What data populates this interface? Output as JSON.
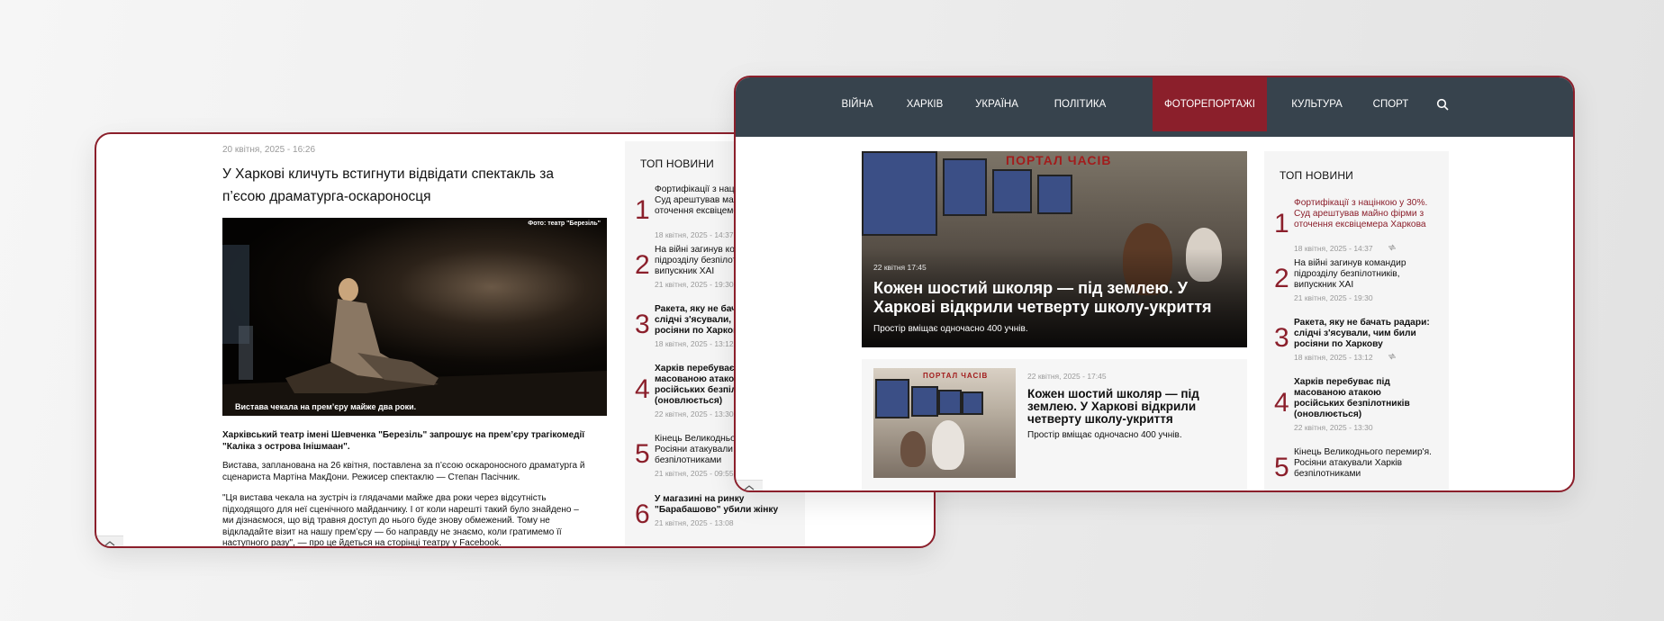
{
  "article": {
    "date": "20 квітня, 2025 - 16:26",
    "title": "У Харкові кличуть встигнути відвідати спектакль за п’єсою драматурга-оскароносця",
    "photo_credit": "Фото: театр \"Березіль\"",
    "photo_caption": "Вистава чекала на прем’єру майже два роки.",
    "lead": "Харківський театр імені Шевченка \"Березіль\" запрошує на прем’єру трагікомедії \"Каліка з острова Інішмаан\".",
    "para1": "Вистава, запланована на 26 квітня, поставлена за п’єсою оскароносного драматурга й сценариста Мартіна МакДони. Режисер спектаклю —  Степан Пасічник.",
    "para2": "\"Ця вистава чекала на зустріч із глядачами майже два роки через відсутність підходящого для неї сценічного майданчику. І от коли нарешті такий було знайдено – ми дізнаємося, що від травня доступ до нього буде знову обмежений. Тому не відкладайте візит на нашу прем’єру — бо направду не знаємо, коли гратимемо її наступного разу\", — про це йдеться на сторінці театру у Facebook."
  },
  "top_news": {
    "heading": "ТОП НОВИНИ",
    "items": [
      {
        "num": "1",
        "title": "Фортифікації з націнкою у 30%. Суд арештував майно фірми з оточення ексвіцемера Харкова",
        "date": "18 квітня, 2025 - 14:37"
      },
      {
        "num": "2",
        "title": "На війні загинув командир підрозділу безпілотників, випускник ХАІ",
        "date": "21 квітня, 2025 - 19:30"
      },
      {
        "num": "3",
        "title": "Ракета, яку не бачать радари: слідчі з'ясували, чим били росіяни по Харкову",
        "date": "18 квітня, 2025 - 13:12"
      },
      {
        "num": "4",
        "title": "Харків перебуває під масованою атакою російських безпілотників (оновлюється)",
        "date": "22 квітня, 2025 - 13:30"
      },
      {
        "num": "5",
        "title": "Кінець Великоднього перемир'я. Росіяни атакували Харків безпілотниками",
        "date": "21 квітня, 2025 - 09:55"
      },
      {
        "num": "6",
        "title": "У магазині на ринку \"Барабашово\" убили жінку",
        "date": "21 квітня, 2025 - 13:08"
      }
    ]
  },
  "nav": {
    "items": [
      "ВІЙНА",
      "ХАРКІВ",
      "УКРАЇНА",
      "ПОЛІТИКА",
      "ФОТОРЕПОРТАЖІ",
      "КУЛЬТУРА",
      "СПОРТ"
    ],
    "active": "ФОТОРЕПОРТАЖІ",
    "search_icon": "search-icon"
  },
  "hero": {
    "date": "22 квітня 17:45",
    "title": "Кожен шостий школяр — під землею. У Харкові відкрили четверту школу-укриття",
    "subtitle": "Простір вміщає одночасно 400 учнів.",
    "sign": "ПОРТАЛ ЧАСІВ"
  },
  "card": {
    "date": "22 квітня, 2025 - 17:45",
    "title": "Кожен шостий школяр — під землею. У Харкові відкрили четверту школу-укриття",
    "subtitle": "Простір вміщає одночасно 400 учнів.",
    "sign": "ПОРТАЛ ЧАСІВ"
  },
  "colors": {
    "accent": "#8b1f2b",
    "navbar": "#37434d",
    "panel": "#f5f5f5"
  }
}
